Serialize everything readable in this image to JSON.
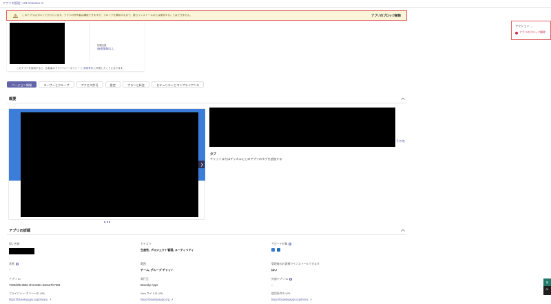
{
  "breadcrumb": {
    "parent": "アプリの管理",
    "current": "123 Notetaker AI"
  },
  "banner": {
    "message": "このアプリはブロックされています。アプリの所有者は構成できますが、ブロックを解除するまで、誰もインストールまたは使用することはできません。",
    "action": "アプリのブロック解除"
  },
  "side_panel": {
    "actions_label": "アクション",
    "unblock_label": "アプリのブロック解除"
  },
  "info_card": {
    "pricing_label": "初期日数",
    "pricing_value": "価格情報なし",
    "terms_prefix": "このアプリを使用すると、比較者のプライバシー ポリシー",
    "terms_mid": " と ",
    "terms_link": "使用条件",
    "terms_suffix": " に同意したことになります。"
  },
  "tabs": [
    "バージョン情報",
    "ユーザーとグループ",
    "アクセス許可",
    "設定",
    "プランと料金",
    "セキュリティとコンプライアンス"
  ],
  "overview": {
    "title": "概要",
    "more": "その他",
    "feature_title": "タブ",
    "feature_desc": "チャットまたはチャネルにこのアプリのタブを追加する"
  },
  "details": {
    "title": "アプリの詳細",
    "short_name_label": "短い名前",
    "categories_label": "カテゴリ",
    "categories_value": "生産性, プロジェクト管理, ユーティリティ",
    "supported_label": "サポート対象",
    "version_label": "状態",
    "version_value": "--",
    "scope_label": "範囲",
    "scope_value": "チーム, グループ チャット",
    "admin_label": "管理者のお客様でインストールできます",
    "admin_value": "はい",
    "app_id_label": "アプリ ID",
    "app_id_value": "7339d3f6-8656-4f4d-8d51-53e6a7fc7381",
    "publisher_label": "発行元",
    "publisher_value": "BlueSky Apps",
    "external_label": "外部アプリ ID",
    "external_value": "--",
    "privacy_label": "プライバシー ポリシーの URL",
    "privacy_value": "https://blueskyapps.org/privacy",
    "website_label": "Web サイトの URL",
    "website_value": "https://blueskyapps.org",
    "terms_label": "使用条件の URL",
    "terms_value": "https://blueskyapps.org/terms"
  },
  "corner_widget": {
    "top": "Q",
    "bottom": "01"
  },
  "colors": {
    "accent": "#6264a7",
    "danger": "#c4314b",
    "banner_bg": "#fbf6d9"
  }
}
